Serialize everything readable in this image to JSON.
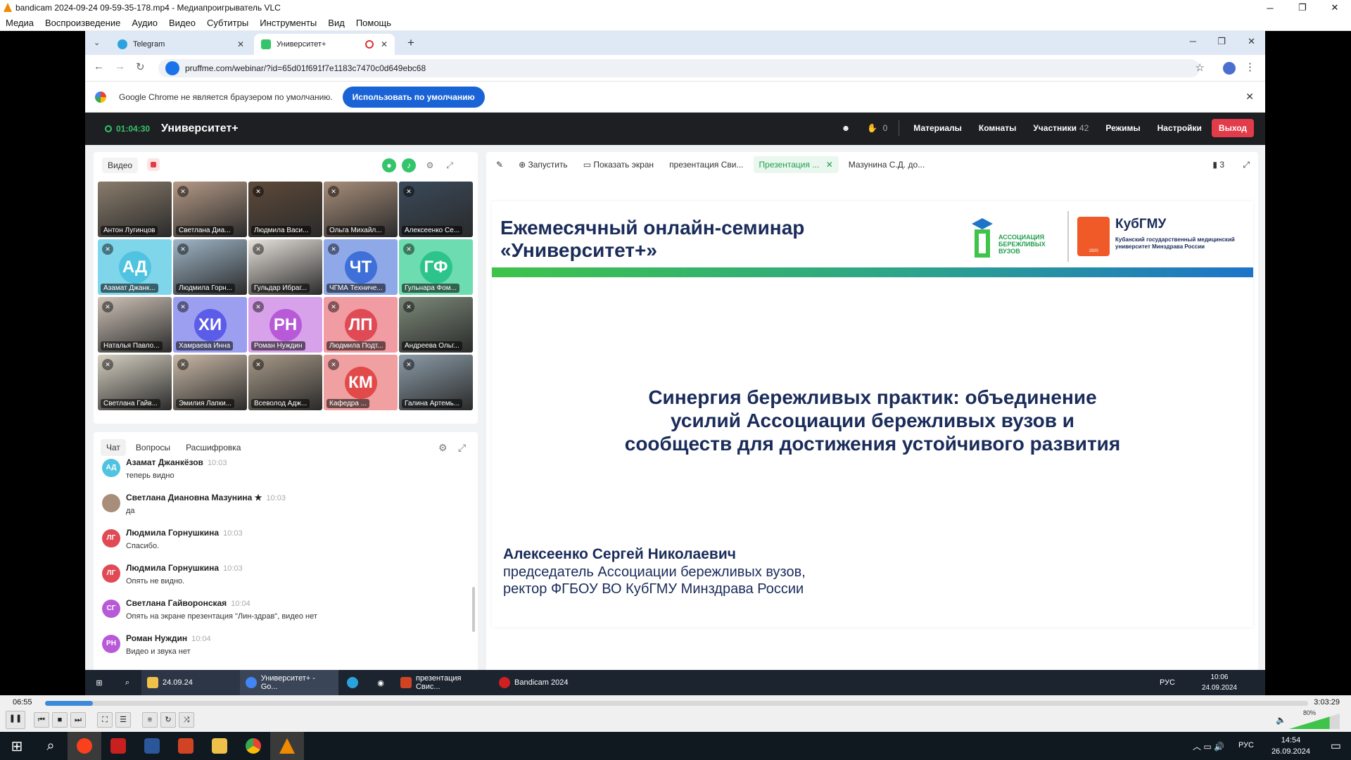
{
  "vlc": {
    "title": "bandicam 2024-09-24 09-59-35-178.mp4 - Медиапроигрыватель VLC",
    "menu": [
      "Медиа",
      "Воспроизведение",
      "Аудио",
      "Видео",
      "Субтитры",
      "Инструменты",
      "Вид",
      "Помощь"
    ],
    "time_current": "06:55",
    "time_total": "3:03:29",
    "progress": 0.038,
    "volume_label": "80%",
    "volume": 0.8
  },
  "browser": {
    "tabs": [
      {
        "label": "Telegram"
      },
      {
        "label": "Университет+"
      }
    ],
    "url": "pruffme.com/webinar/?id=65d01f691f7e1183c7470c0d649ebc68",
    "infobar_text": "Google Chrome не является браузером по умолчанию.",
    "infobar_button": "Использовать по умолчанию"
  },
  "webinar": {
    "timer": "01:04:30",
    "title": "Университет+",
    "hands_count": "0",
    "materials": "Материалы",
    "rooms": "Комнаты",
    "participants": "Участники",
    "participants_count": "42",
    "modes": "Режимы",
    "settings": "Настройки",
    "exit": "Выход",
    "video_label": "Видео",
    "tiles": [
      {
        "name": "Антон Лугинцов",
        "type": "photo",
        "color": "#8a7c6c"
      },
      {
        "name": "Светлана Диа...",
        "type": "photo",
        "color": "#b59a86"
      },
      {
        "name": "Людмила Васи...",
        "type": "photo",
        "color": "#5e4a3a"
      },
      {
        "name": "Ольга Михайл...",
        "type": "photo",
        "color": "#a88e7a"
      },
      {
        "name": "Алексеенко Се...",
        "type": "photo",
        "color": "#3a4a5a"
      },
      {
        "name": "Азамат Джанк...",
        "type": "initials",
        "initials": "АД",
        "color": "#4fc3e0",
        "bg": "#7fd6ea"
      },
      {
        "name": "Людмила Горн...",
        "type": "photo",
        "color": "#9fb6c8"
      },
      {
        "name": "Гульдар Ибраг...",
        "type": "photo",
        "color": "#e8e2dc"
      },
      {
        "name": "ЧГМА Техниче...",
        "type": "initials",
        "initials": "ЧТ",
        "color": "#3f6fd8",
        "bg": "#8fa8e8"
      },
      {
        "name": "Гульнара Фом...",
        "type": "initials",
        "initials": "ГФ",
        "color": "#2cc48a",
        "bg": "#6ddcb0"
      },
      {
        "name": "Наталья Павло...",
        "type": "photo",
        "color": "#cfc3b8"
      },
      {
        "name": "Хамраева Инна",
        "type": "initials",
        "initials": "ХИ",
        "color": "#5b5ce8",
        "bg": "#9c9ff0"
      },
      {
        "name": "Роман Нуждин",
        "type": "initials",
        "initials": "РН",
        "color": "#b85ad8",
        "bg": "#d8a2ea"
      },
      {
        "name": "Людмила Подт...",
        "type": "initials",
        "initials": "ЛП",
        "color": "#e04a55",
        "bg": "#f09ca2"
      },
      {
        "name": "Андреева Ольг...",
        "type": "photo",
        "color": "#7d8a7a"
      },
      {
        "name": "Светлана Гайв...",
        "type": "photo",
        "color": "#d6d0c2"
      },
      {
        "name": "Эмилия Лапки...",
        "type": "photo",
        "color": "#c9b8a6"
      },
      {
        "name": "Всеволод Адж...",
        "type": "photo",
        "color": "#a89a88"
      },
      {
        "name": "Кафедра ...",
        "type": "initials",
        "initials": "КМ",
        "color": "#e24a4a",
        "bg": "#f0a0a0"
      },
      {
        "name": "Галина Артемь...",
        "type": "photo",
        "color": "#8c9ca8"
      }
    ],
    "chat_tabs": [
      "Чат",
      "Вопросы",
      "Расшифровка"
    ],
    "messages": [
      {
        "initials": "АД",
        "color": "#4fc3e0",
        "name": "Азамат Джанкёзов",
        "time": "10:03",
        "text": "теперь видно"
      },
      {
        "initials": "",
        "color": "#a88e7a",
        "name": "Светлана Диановна Мазунина ★",
        "time": "10:03",
        "text": "да"
      },
      {
        "initials": "ЛГ",
        "color": "#e04a55",
        "name": "Людмила Горнушкина",
        "time": "10:03",
        "text": "Спасибо."
      },
      {
        "initials": "ЛГ",
        "color": "#e04a55",
        "name": "Людмила Горнушкина",
        "time": "10:03",
        "text": "Опять не видно."
      },
      {
        "initials": "СГ",
        "color": "#b85ad8",
        "name": "Светлана Гайворонская",
        "time": "10:04",
        "text": "Опять на экране презентация \"Лин-здрав\", видео нет"
      },
      {
        "initials": "РН",
        "color": "#b85ad8",
        "name": "Роман Нуждин",
        "time": "10:04",
        "text": "Видео и звука нет"
      }
    ],
    "toolbar": {
      "launch": "Запустить",
      "share": "Показать экран",
      "doc1": "презентация Сви...",
      "doc2": "Презентация ...",
      "doc3": "Мазунина С.Д. до...",
      "bookmarks": "3"
    },
    "slide": {
      "title": "Ежемесячный онлайн-семинар\n«Университет+»",
      "main": [
        "Синергия бережливых практик: объединение",
        "усилий Ассоциации бережливых вузов и",
        "сообществ для достижения устойчивого развития"
      ],
      "speaker": "Алексеенко Сергей Николаевич",
      "position_lines": [
        "председатель Ассоциации бережливых вузов,",
        "ректор ФГБОУ ВО КубГМУ Минздрава России"
      ],
      "logo_assoc": [
        "АССОЦИАЦИЯ",
        "БЕРЕЖЛИВЫХ",
        "ВУЗОВ"
      ],
      "logo_kub_title": "КубГМУ",
      "logo_kub_sub": [
        "Кубанский государственный медицинский",
        "университет Минздрава России"
      ],
      "logo_kub_year": "1920"
    }
  },
  "inner_taskbar": {
    "items": [
      "24.09.24",
      "Университет+ - Go...",
      "презентация Свис...",
      "Bandicam 2024"
    ],
    "lang": "РУС",
    "time": "10:06",
    "date": "24.09.2024"
  },
  "taskbar": {
    "lang": "РУС",
    "time": "14:54",
    "date": "26.09.2024"
  }
}
